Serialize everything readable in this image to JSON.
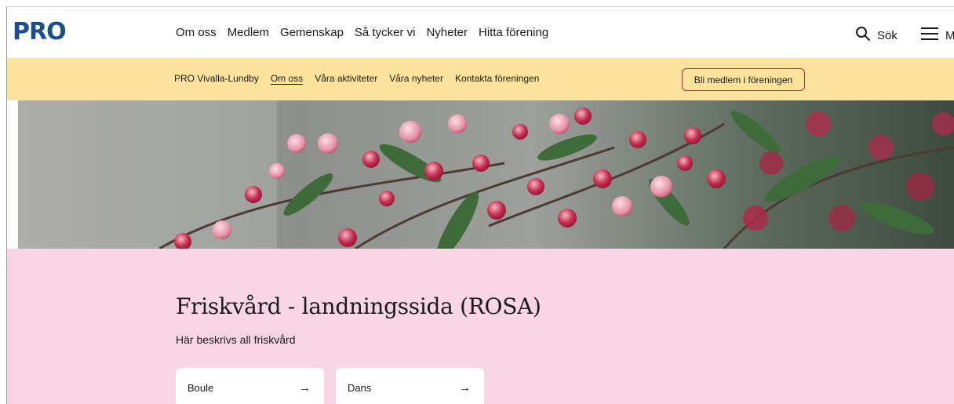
{
  "header": {
    "logo": "PRO",
    "nav": [
      "Om oss",
      "Medlem",
      "Gemenskap",
      "Så tycker vi",
      "Nyheter",
      "Hitta förening"
    ],
    "search_label": "Sök",
    "menu_label": "Me"
  },
  "sub_nav": {
    "links": [
      "PRO Vivalla-Lundby",
      "Om oss",
      "Våra aktiviteter",
      "Våra nyheter",
      "Kontakta föreningen"
    ],
    "active": "Om oss",
    "join_button": "Bli medlem i föreningen"
  },
  "main": {
    "title": "Friskvård - landningssida (ROSA)",
    "description": "Här beskrivs all friskvård",
    "cards": [
      {
        "label": "Boule",
        "arrow": "→"
      },
      {
        "label": "Dans",
        "arrow": "→"
      }
    ]
  },
  "colors": {
    "brand_blue": "#1a4e8f",
    "subnav_yellow": "#fce39c",
    "accent_red": "#c2243e",
    "section_pink": "#f8d5e4"
  }
}
